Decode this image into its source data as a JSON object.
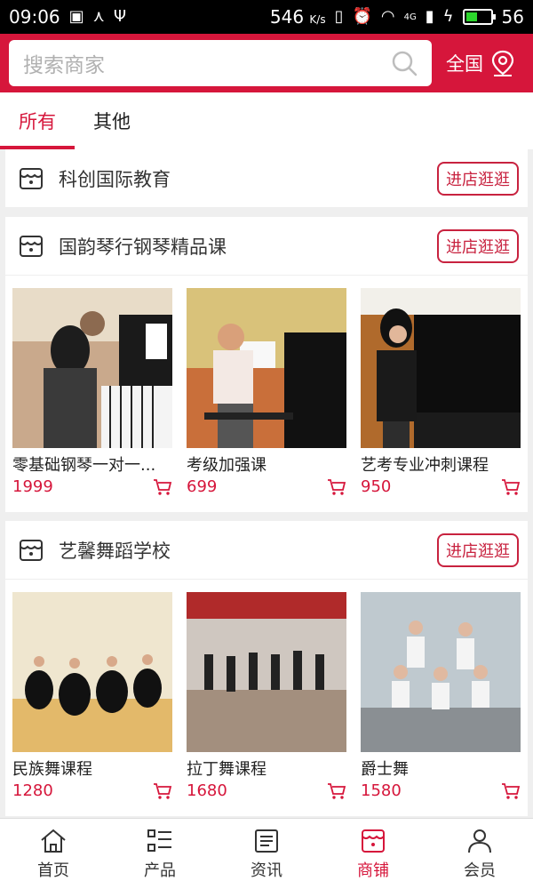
{
  "status_bar": {
    "time": "09:06",
    "speed": "546",
    "speed_unit": "K/s",
    "battery": "56",
    "battery_level": 0.56,
    "network": "4G"
  },
  "header": {
    "search_placeholder": "搜索商家",
    "region_label": "全国",
    "accent_color": "#d6163b"
  },
  "tabs": [
    {
      "label": "所有",
      "active": true
    },
    {
      "label": "其他",
      "active": false
    }
  ],
  "shops": [
    {
      "name": "科创国际教育",
      "button": "进店逛逛",
      "products": []
    },
    {
      "name": "国韵琴行钢琴精品课",
      "button": "进店逛逛",
      "products": [
        {
          "name": "零基础钢琴一对一...",
          "price": "1999"
        },
        {
          "name": "考级加强课",
          "price": "699"
        },
        {
          "name": "艺考专业冲刺课程",
          "price": "950"
        }
      ]
    },
    {
      "name": "艺馨舞蹈学校",
      "button": "进店逛逛",
      "products": [
        {
          "name": "民族舞课程",
          "price": "1280"
        },
        {
          "name": "拉丁舞课程",
          "price": "1680"
        },
        {
          "name": "爵士舞",
          "price": "1580"
        }
      ]
    }
  ],
  "bottom_nav": [
    {
      "label": "首页",
      "icon": "home-icon",
      "active": false
    },
    {
      "label": "产品",
      "icon": "list-icon",
      "active": false
    },
    {
      "label": "资讯",
      "icon": "news-icon",
      "active": false
    },
    {
      "label": "商铺",
      "icon": "store-icon",
      "active": true
    },
    {
      "label": "会员",
      "icon": "user-icon",
      "active": false
    }
  ]
}
